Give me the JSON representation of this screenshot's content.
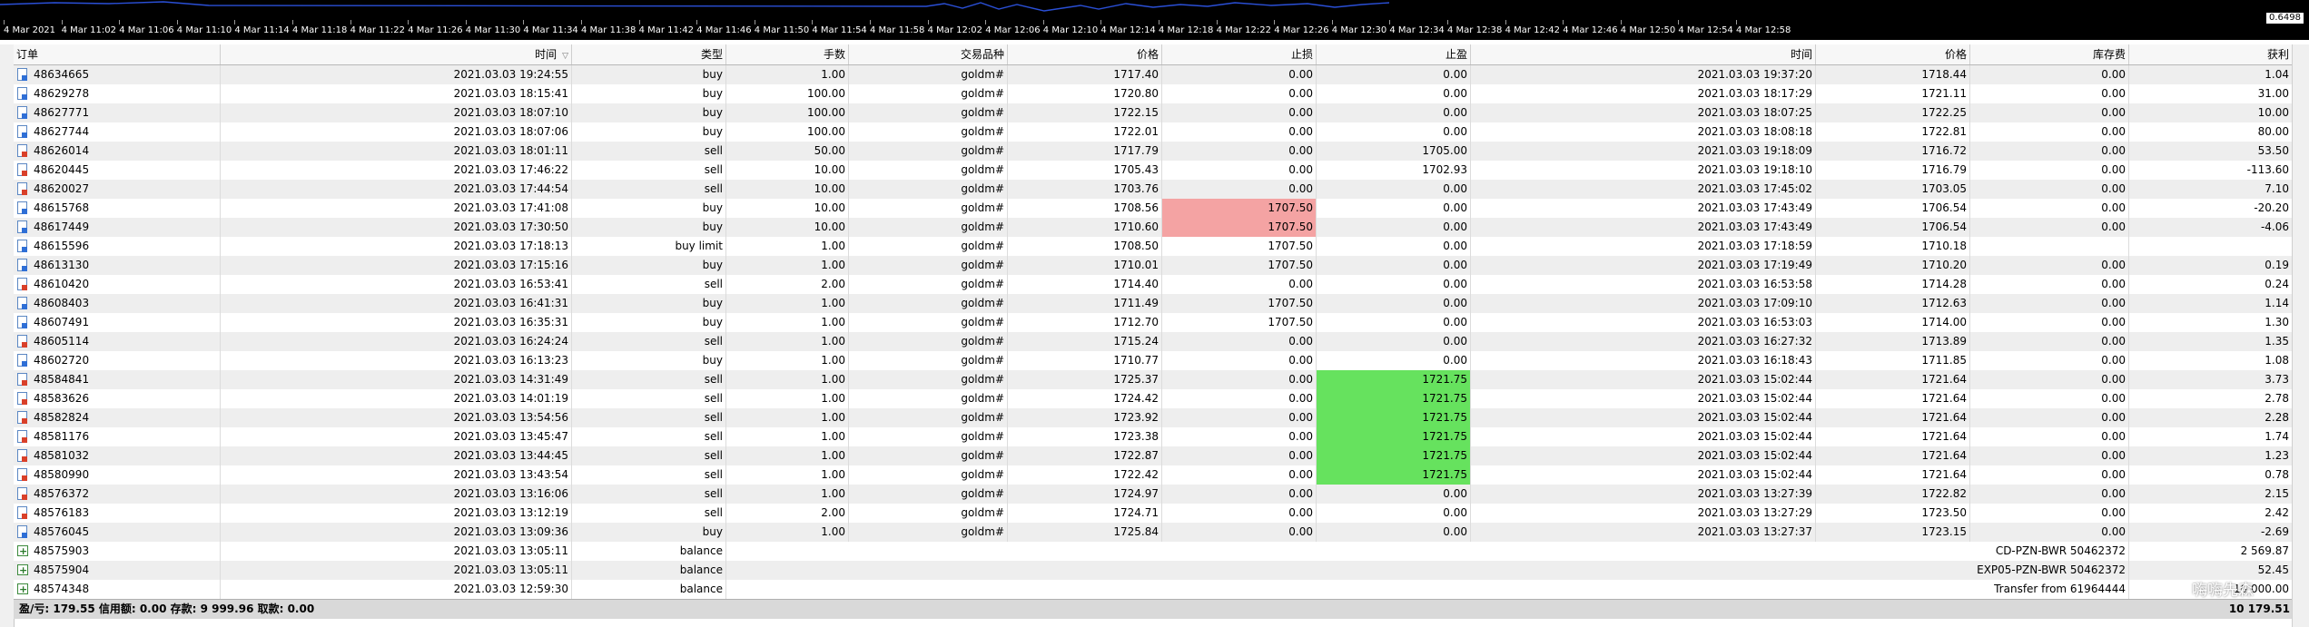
{
  "chart": {
    "price_label": "0.6498",
    "time_labels": [
      "4 Mar 2021",
      "4 Mar 11:02",
      "4 Mar 11:06",
      "4 Mar 11:10",
      "4 Mar 11:14",
      "4 Mar 11:18",
      "4 Mar 11:22",
      "4 Mar 11:26",
      "4 Mar 11:30",
      "4 Mar 11:34",
      "4 Mar 11:38",
      "4 Mar 11:42",
      "4 Mar 11:46",
      "4 Mar 11:50",
      "4 Mar 11:54",
      "4 Mar 11:58",
      "4 Mar 12:02",
      "4 Mar 12:06",
      "4 Mar 12:10",
      "4 Mar 12:14",
      "4 Mar 12:18",
      "4 Mar 12:22",
      "4 Mar 12:26",
      "4 Mar 12:30",
      "4 Mar 12:34",
      "4 Mar 12:38",
      "4 Mar 12:42",
      "4 Mar 12:46",
      "4 Mar 12:50",
      "4 Mar 12:54",
      "4 Mar 12:58"
    ],
    "line_color": "#2a4fd6"
  },
  "columns": [
    "订单",
    "时间",
    "类型",
    "手数",
    "交易品种",
    "价格",
    "止损",
    "止盈",
    "时间",
    "价格",
    "库存费",
    "获利"
  ],
  "sort_indicator": "▽",
  "colors": {
    "sl_hit": "#f4a3a3",
    "tp_hit": "#66e25e"
  },
  "rows": [
    {
      "ticket": "48634665",
      "open_time": "2021.03.03 19:24:55",
      "type": "buy",
      "lots": "1.00",
      "symbol": "goldm#",
      "open_price": "1717.40",
      "sl": "0.00",
      "tp": "0.00",
      "close_time": "2021.03.03 19:37:20",
      "close_price": "1718.44",
      "swap": "0.00",
      "profit": "1.04"
    },
    {
      "ticket": "48629278",
      "open_time": "2021.03.03 18:15:41",
      "type": "buy",
      "lots": "100.00",
      "symbol": "goldm#",
      "open_price": "1720.80",
      "sl": "0.00",
      "tp": "0.00",
      "close_time": "2021.03.03 18:17:29",
      "close_price": "1721.11",
      "swap": "0.00",
      "profit": "31.00"
    },
    {
      "ticket": "48627771",
      "open_time": "2021.03.03 18:07:10",
      "type": "buy",
      "lots": "100.00",
      "symbol": "goldm#",
      "open_price": "1722.15",
      "sl": "0.00",
      "tp": "0.00",
      "close_time": "2021.03.03 18:07:25",
      "close_price": "1722.25",
      "swap": "0.00",
      "profit": "10.00"
    },
    {
      "ticket": "48627744",
      "open_time": "2021.03.03 18:07:06",
      "type": "buy",
      "lots": "100.00",
      "symbol": "goldm#",
      "open_price": "1722.01",
      "sl": "0.00",
      "tp": "0.00",
      "close_time": "2021.03.03 18:08:18",
      "close_price": "1722.81",
      "swap": "0.00",
      "profit": "80.00"
    },
    {
      "ticket": "48626014",
      "open_time": "2021.03.03 18:01:11",
      "type": "sell",
      "lots": "50.00",
      "symbol": "goldm#",
      "open_price": "1717.79",
      "sl": "0.00",
      "tp": "1705.00",
      "close_time": "2021.03.03 19:18:09",
      "close_price": "1716.72",
      "swap": "0.00",
      "profit": "53.50"
    },
    {
      "ticket": "48620445",
      "open_time": "2021.03.03 17:46:22",
      "type": "sell",
      "lots": "10.00",
      "symbol": "goldm#",
      "open_price": "1705.43",
      "sl": "0.00",
      "tp": "1702.93",
      "close_time": "2021.03.03 19:18:10",
      "close_price": "1716.79",
      "swap": "0.00",
      "profit": "-113.60"
    },
    {
      "ticket": "48620027",
      "open_time": "2021.03.03 17:44:54",
      "type": "sell",
      "lots": "10.00",
      "symbol": "goldm#",
      "open_price": "1703.76",
      "sl": "0.00",
      "tp": "0.00",
      "close_time": "2021.03.03 17:45:02",
      "close_price": "1703.05",
      "swap": "0.00",
      "profit": "7.10"
    },
    {
      "ticket": "48615768",
      "open_time": "2021.03.03 17:41:08",
      "type": "buy",
      "lots": "10.00",
      "symbol": "goldm#",
      "open_price": "1708.56",
      "sl": "1707.50",
      "sl_hl": "red",
      "tp": "0.00",
      "close_time": "2021.03.03 17:43:49",
      "close_price": "1706.54",
      "swap": "0.00",
      "profit": "-20.20"
    },
    {
      "ticket": "48617449",
      "open_time": "2021.03.03 17:30:50",
      "type": "buy",
      "lots": "10.00",
      "symbol": "goldm#",
      "open_price": "1710.60",
      "sl": "1707.50",
      "sl_hl": "red",
      "tp": "0.00",
      "close_time": "2021.03.03 17:43:49",
      "close_price": "1706.54",
      "swap": "0.00",
      "profit": "-4.06"
    },
    {
      "ticket": "48615596",
      "open_time": "2021.03.03 17:18:13",
      "type": "buy limit",
      "lots": "1.00",
      "symbol": "goldm#",
      "open_price": "1708.50",
      "sl": "1707.50",
      "tp": "0.00",
      "close_time": "2021.03.03 17:18:59",
      "close_price": "1710.18",
      "swap": "",
      "profit": ""
    },
    {
      "ticket": "48613130",
      "open_time": "2021.03.03 17:15:16",
      "type": "buy",
      "lots": "1.00",
      "symbol": "goldm#",
      "open_price": "1710.01",
      "sl": "1707.50",
      "tp": "0.00",
      "close_time": "2021.03.03 17:19:49",
      "close_price": "1710.20",
      "swap": "0.00",
      "profit": "0.19"
    },
    {
      "ticket": "48610420",
      "open_time": "2021.03.03 16:53:41",
      "type": "sell",
      "lots": "2.00",
      "symbol": "goldm#",
      "open_price": "1714.40",
      "sl": "0.00",
      "tp": "0.00",
      "close_time": "2021.03.03 16:53:58",
      "close_price": "1714.28",
      "swap": "0.00",
      "profit": "0.24"
    },
    {
      "ticket": "48608403",
      "open_time": "2021.03.03 16:41:31",
      "type": "buy",
      "lots": "1.00",
      "symbol": "goldm#",
      "open_price": "1711.49",
      "sl": "1707.50",
      "tp": "0.00",
      "close_time": "2021.03.03 17:09:10",
      "close_price": "1712.63",
      "swap": "0.00",
      "profit": "1.14"
    },
    {
      "ticket": "48607491",
      "open_time": "2021.03.03 16:35:31",
      "type": "buy",
      "lots": "1.00",
      "symbol": "goldm#",
      "open_price": "1712.70",
      "sl": "1707.50",
      "tp": "0.00",
      "close_time": "2021.03.03 16:53:03",
      "close_price": "1714.00",
      "swap": "0.00",
      "profit": "1.30"
    },
    {
      "ticket": "48605114",
      "open_time": "2021.03.03 16:24:24",
      "type": "sell",
      "lots": "1.00",
      "symbol": "goldm#",
      "open_price": "1715.24",
      "sl": "0.00",
      "tp": "0.00",
      "close_time": "2021.03.03 16:27:32",
      "close_price": "1713.89",
      "swap": "0.00",
      "profit": "1.35"
    },
    {
      "ticket": "48602720",
      "open_time": "2021.03.03 16:13:23",
      "type": "buy",
      "lots": "1.00",
      "symbol": "goldm#",
      "open_price": "1710.77",
      "sl": "0.00",
      "tp": "0.00",
      "close_time": "2021.03.03 16:18:43",
      "close_price": "1711.85",
      "swap": "0.00",
      "profit": "1.08"
    },
    {
      "ticket": "48584841",
      "open_time": "2021.03.03 14:31:49",
      "type": "sell",
      "lots": "1.00",
      "symbol": "goldm#",
      "open_price": "1725.37",
      "sl": "0.00",
      "tp": "1721.75",
      "tp_hl": "green",
      "close_time": "2021.03.03 15:02:44",
      "close_price": "1721.64",
      "swap": "0.00",
      "profit": "3.73"
    },
    {
      "ticket": "48583626",
      "open_time": "2021.03.03 14:01:19",
      "type": "sell",
      "lots": "1.00",
      "symbol": "goldm#",
      "open_price": "1724.42",
      "sl": "0.00",
      "tp": "1721.75",
      "tp_hl": "green",
      "close_time": "2021.03.03 15:02:44",
      "close_price": "1721.64",
      "swap": "0.00",
      "profit": "2.78"
    },
    {
      "ticket": "48582824",
      "open_time": "2021.03.03 13:54:56",
      "type": "sell",
      "lots": "1.00",
      "symbol": "goldm#",
      "open_price": "1723.92",
      "sl": "0.00",
      "tp": "1721.75",
      "tp_hl": "green",
      "close_time": "2021.03.03 15:02:44",
      "close_price": "1721.64",
      "swap": "0.00",
      "profit": "2.28"
    },
    {
      "ticket": "48581176",
      "open_time": "2021.03.03 13:45:47",
      "type": "sell",
      "lots": "1.00",
      "symbol": "goldm#",
      "open_price": "1723.38",
      "sl": "0.00",
      "tp": "1721.75",
      "tp_hl": "green",
      "close_time": "2021.03.03 15:02:44",
      "close_price": "1721.64",
      "swap": "0.00",
      "profit": "1.74"
    },
    {
      "ticket": "48581032",
      "open_time": "2021.03.03 13:44:45",
      "type": "sell",
      "lots": "1.00",
      "symbol": "goldm#",
      "open_price": "1722.87",
      "sl": "0.00",
      "tp": "1721.75",
      "tp_hl": "green",
      "close_time": "2021.03.03 15:02:44",
      "close_price": "1721.64",
      "swap": "0.00",
      "profit": "1.23"
    },
    {
      "ticket": "48580990",
      "open_time": "2021.03.03 13:43:54",
      "type": "sell",
      "lots": "1.00",
      "symbol": "goldm#",
      "open_price": "1722.42",
      "sl": "0.00",
      "tp": "1721.75",
      "tp_hl": "green",
      "close_time": "2021.03.03 15:02:44",
      "close_price": "1721.64",
      "swap": "0.00",
      "profit": "0.78"
    },
    {
      "ticket": "48576372",
      "open_time": "2021.03.03 13:16:06",
      "type": "sell",
      "lots": "1.00",
      "symbol": "goldm#",
      "open_price": "1724.97",
      "sl": "0.00",
      "tp": "0.00",
      "close_time": "2021.03.03 13:27:39",
      "close_price": "1722.82",
      "swap": "0.00",
      "profit": "2.15"
    },
    {
      "ticket": "48576183",
      "open_time": "2021.03.03 13:12:19",
      "type": "sell",
      "lots": "2.00",
      "symbol": "goldm#",
      "open_price": "1724.71",
      "sl": "0.00",
      "tp": "0.00",
      "close_time": "2021.03.03 13:27:29",
      "close_price": "1723.50",
      "swap": "0.00",
      "profit": "2.42"
    },
    {
      "ticket": "48576045",
      "open_time": "2021.03.03 13:09:36",
      "type": "buy",
      "lots": "1.00",
      "symbol": "goldm#",
      "open_price": "1725.84",
      "sl": "0.00",
      "tp": "0.00",
      "close_time": "2021.03.03 13:27:37",
      "close_price": "1723.15",
      "swap": "0.00",
      "profit": "-2.69"
    }
  ],
  "balance_rows": [
    {
      "ticket": "48575903",
      "time": "2021.03.03 13:05:11",
      "type": "balance",
      "comment": "CD-PZN-BWR 50462372",
      "profit": "2 569.87"
    },
    {
      "ticket": "48575904",
      "time": "2021.03.03 13:05:11",
      "type": "balance",
      "comment": "EXP05-PZN-BWR 50462372",
      "profit": "52.45"
    },
    {
      "ticket": "48574348",
      "time": "2021.03.03 12:59:30",
      "type": "balance",
      "comment": "Transfer from 61964444",
      "profit": "10 000.00"
    }
  ],
  "summary": {
    "text": "盈/亏: 179.55  信用额: 0.00  存款: 9 999.96  取款: 0.00",
    "total": "10 179.51"
  },
  "watermark": "嗨嗨先森"
}
